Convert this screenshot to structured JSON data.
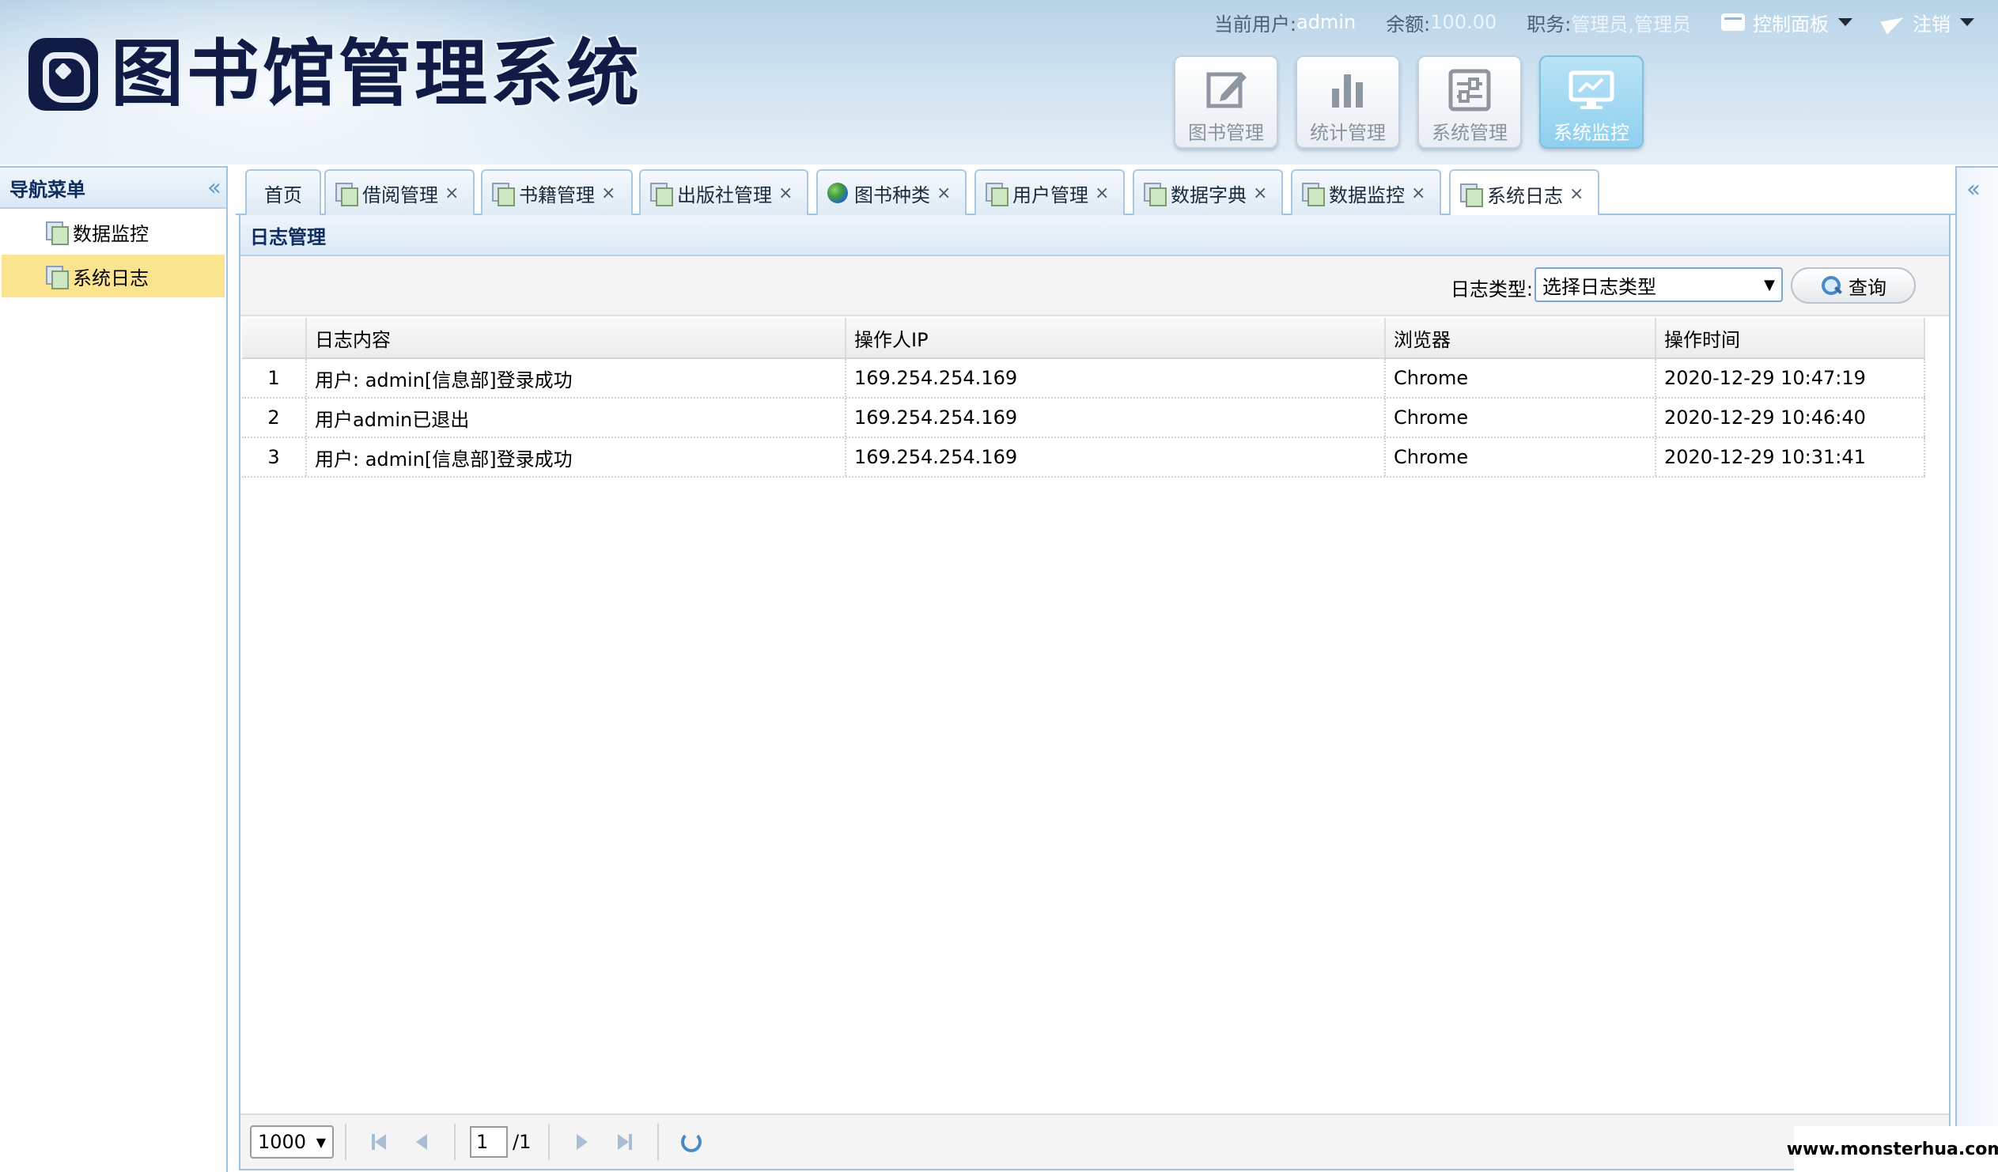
{
  "header": {
    "logo_text": "图书馆管理系统",
    "user_label": "当前用户:",
    "user_value": "admin",
    "balance_label": "余额:",
    "balance_value": "100.00",
    "role_label": "职务:",
    "role_value": "管理员,管理员",
    "control_panel": "控制面板",
    "logout": "注销",
    "modules": [
      {
        "label": "图书管理",
        "icon": "edit-icon",
        "active": false
      },
      {
        "label": "统计管理",
        "icon": "bar-chart-icon",
        "active": false
      },
      {
        "label": "系统管理",
        "icon": "settings-panel-icon",
        "active": false
      },
      {
        "label": "系统监控",
        "icon": "monitor-icon",
        "active": true
      }
    ]
  },
  "sidebar": {
    "title": "导航菜单",
    "items": [
      {
        "label": "数据监控",
        "active": false
      },
      {
        "label": "系统日志",
        "active": true
      }
    ]
  },
  "tabs": [
    {
      "label": "首页",
      "closable": false,
      "icon": ""
    },
    {
      "label": "借阅管理",
      "closable": true,
      "icon": "doc-icon"
    },
    {
      "label": "书籍管理",
      "closable": true,
      "icon": "doc-icon"
    },
    {
      "label": "出版社管理",
      "closable": true,
      "icon": "doc-icon"
    },
    {
      "label": "图书种类",
      "closable": true,
      "icon": "globe-icon"
    },
    {
      "label": "用户管理",
      "closable": true,
      "icon": "doc-icon"
    },
    {
      "label": "数据字典",
      "closable": true,
      "icon": "doc-icon"
    },
    {
      "label": "数据监控",
      "closable": true,
      "icon": "doc-icon"
    },
    {
      "label": "系统日志",
      "closable": true,
      "icon": "doc-icon",
      "active": true
    }
  ],
  "panel": {
    "title": "日志管理",
    "filter_label": "日志类型:",
    "filter_placeholder": "选择日志类型",
    "query_button": "查询"
  },
  "grid": {
    "columns": [
      "日志内容",
      "操作人IP",
      "浏览器",
      "操作时间"
    ],
    "rows": [
      {
        "num": "1",
        "content": "用户: admin[信息部]登录成功",
        "ip": "169.254.254.169",
        "browser": "Chrome",
        "time": "2020-12-29 10:47:19"
      },
      {
        "num": "2",
        "content": "用户admin已退出",
        "ip": "169.254.254.169",
        "browser": "Chrome",
        "time": "2020-12-29 10:46:40"
      },
      {
        "num": "3",
        "content": "用户: admin[信息部]登录成功",
        "ip": "169.254.254.169",
        "browser": "Chrome",
        "time": "2020-12-29 10:31:41"
      }
    ]
  },
  "pager": {
    "page_size": "1000",
    "current_page": "1",
    "total_pages": "/1"
  },
  "watermark": "www.monsterhua.com",
  "colors": {
    "header_bg": "#cfe2f0",
    "border": "#9fc3e3",
    "active_nav": "#fbe48f",
    "logo": "#101c45"
  }
}
